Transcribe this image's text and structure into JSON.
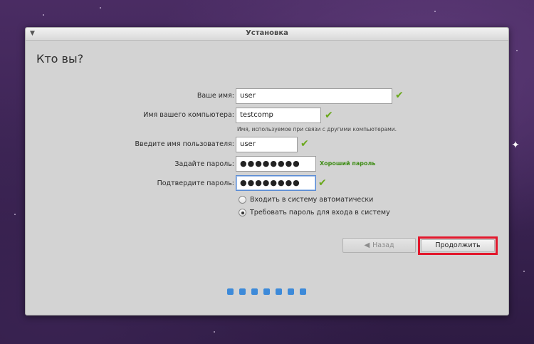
{
  "window": {
    "title": "Установка",
    "heading": "Кто вы?"
  },
  "form": {
    "name_label": "Ваше имя:",
    "name_value": "user",
    "computer_label": "Имя вашего компьютера:",
    "computer_value": "testcomp",
    "computer_hint": "Имя, используемое при связи с другими компьютерами.",
    "username_label": "Введите имя пользователя:",
    "username_value": "user",
    "password_label": "Задайте пароль:",
    "password_mask": "●●●●●●●●",
    "password_strength": "Хороший пароль",
    "confirm_label": "Подтвердите пароль:",
    "confirm_mask": "●●●●●●●●"
  },
  "login_options": [
    {
      "label": "Входить в систему автоматически",
      "selected": false
    },
    {
      "label": "Требовать пароль для входа в систему",
      "selected": true
    }
  ],
  "buttons": {
    "back_label": "Назад",
    "continue_label": "Продолжить"
  },
  "progress": {
    "total_steps": 7
  },
  "colors": {
    "accent": "#3d8ad9",
    "check": "#6aa81b",
    "strength": "#3d8c14",
    "highlight": "#e2172c"
  },
  "icons": {
    "window_menu": "chevron-down-icon",
    "valid": "checkmark-icon",
    "back": "arrow-left-icon"
  }
}
